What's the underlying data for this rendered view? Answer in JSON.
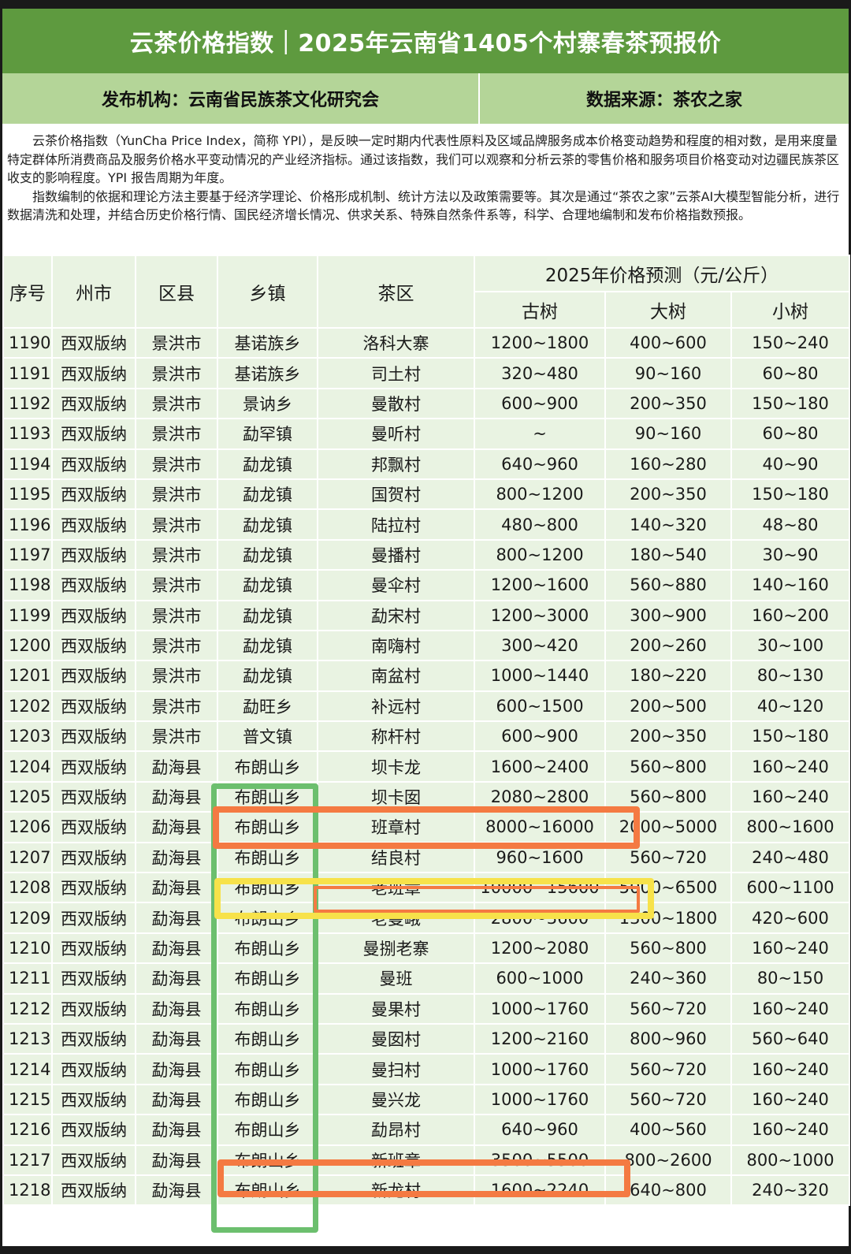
{
  "title": "云茶价格指数｜2025年云南省1405个村寨春茶预报价",
  "publisher": "发布机构：云南省民族茶文化研究会",
  "source": "数据来源：茶农之家",
  "intro": {
    "p1": "云茶价格指数（YunCha Price Index，简称 YPI），是反映一定时期内代表性原料及区域品牌服务成本价格变动趋势和程度的相对数，是用来度量特定群体所消费商品及服务价格水平变动情况的产业经济指标。通过该指数，我们可以观察和分析云茶的零售价格和服务项目价格变动对边疆民族茶区收支的影响程度。YPI 报告周期为年度。",
    "p2": "指数编制的依据和理论方法主要基于经济学理论、价格形成机制、统计方法以及政策需要等。其次是通过“茶农之家”云茶AI大模型智能分析，进行数据清洗和处理，并结合历史价格行情、国民经济增长情况、供求关系、特殊自然条件系等，科学、合理地编制和发布价格指数预报。"
  },
  "table": {
    "headers": {
      "index": "序号",
      "prefecture": "州市",
      "county": "区县",
      "township": "乡镇",
      "tea_area": "茶区",
      "forecast": "2025年价格预测（元/公斤）",
      "ancient": "古树",
      "large": "大树",
      "small": "小树"
    },
    "rows": [
      [
        "1190",
        "西双版纳",
        "景洪市",
        "基诺族乡",
        "洛科大寨",
        "1200~1800",
        "400~600",
        "150~240"
      ],
      [
        "1191",
        "西双版纳",
        "景洪市",
        "基诺族乡",
        "司土村",
        "320~480",
        "90~160",
        "60~80"
      ],
      [
        "1192",
        "西双版纳",
        "景洪市",
        "景讷乡",
        "曼散村",
        "600~900",
        "200~350",
        "150~180"
      ],
      [
        "1193",
        "西双版纳",
        "景洪市",
        "勐罕镇",
        "曼听村",
        "~",
        "90~160",
        "60~80"
      ],
      [
        "1194",
        "西双版纳",
        "景洪市",
        "勐龙镇",
        "邦飘村",
        "640~960",
        "160~280",
        "40~90"
      ],
      [
        "1195",
        "西双版纳",
        "景洪市",
        "勐龙镇",
        "国贺村",
        "800~1200",
        "200~350",
        "150~180"
      ],
      [
        "1196",
        "西双版纳",
        "景洪市",
        "勐龙镇",
        "陆拉村",
        "480~800",
        "140~320",
        "48~80"
      ],
      [
        "1197",
        "西双版纳",
        "景洪市",
        "勐龙镇",
        "曼播村",
        "800~1200",
        "180~540",
        "30~90"
      ],
      [
        "1198",
        "西双版纳",
        "景洪市",
        "勐龙镇",
        "曼伞村",
        "1200~1600",
        "560~880",
        "140~160"
      ],
      [
        "1199",
        "西双版纳",
        "景洪市",
        "勐龙镇",
        "勐宋村",
        "1200~3000",
        "300~900",
        "160~200"
      ],
      [
        "1200",
        "西双版纳",
        "景洪市",
        "勐龙镇",
        "南嗨村",
        "300~420",
        "200~260",
        "30~100"
      ],
      [
        "1201",
        "西双版纳",
        "景洪市",
        "勐龙镇",
        "南盆村",
        "1000~1440",
        "180~220",
        "80~130"
      ],
      [
        "1202",
        "西双版纳",
        "景洪市",
        "勐旺乡",
        "补远村",
        "600~1500",
        "200~500",
        "40~120"
      ],
      [
        "1203",
        "西双版纳",
        "景洪市",
        "普文镇",
        "称杆村",
        "600~900",
        "200~350",
        "150~180"
      ],
      [
        "1204",
        "西双版纳",
        "勐海县",
        "布朗山乡",
        "坝卡龙",
        "1600~2400",
        "560~800",
        "160~240"
      ],
      [
        "1205",
        "西双版纳",
        "勐海县",
        "布朗山乡",
        "坝卡囡",
        "2080~2800",
        "560~800",
        "160~240"
      ],
      [
        "1206",
        "西双版纳",
        "勐海县",
        "布朗山乡",
        "班章村",
        "8000~16000",
        "2000~5000",
        "800~1600"
      ],
      [
        "1207",
        "西双版纳",
        "勐海县",
        "布朗山乡",
        "结良村",
        "960~1600",
        "560~720",
        "240~480"
      ],
      [
        "1208",
        "西双版纳",
        "勐海县",
        "布朗山乡",
        "老班章",
        "10000~15600",
        "5000~6500",
        "600~1100"
      ],
      [
        "1209",
        "西双版纳",
        "勐海县",
        "布朗山乡",
        "老曼峨",
        "2800~3600",
        "1300~1800",
        "420~600"
      ],
      [
        "1210",
        "西双版纳",
        "勐海县",
        "布朗山乡",
        "曼捌老寨",
        "1200~2080",
        "560~800",
        "160~240"
      ],
      [
        "1211",
        "西双版纳",
        "勐海县",
        "布朗山乡",
        "曼班",
        "600~1000",
        "240~360",
        "80~150"
      ],
      [
        "1212",
        "西双版纳",
        "勐海县",
        "布朗山乡",
        "曼果村",
        "1000~1760",
        "560~720",
        "160~240"
      ],
      [
        "1213",
        "西双版纳",
        "勐海县",
        "布朗山乡",
        "曼囡村",
        "1200~2160",
        "800~960",
        "560~640"
      ],
      [
        "1214",
        "西双版纳",
        "勐海县",
        "布朗山乡",
        "曼扫村",
        "1000~1760",
        "560~720",
        "160~240"
      ],
      [
        "1215",
        "西双版纳",
        "勐海县",
        "布朗山乡",
        "曼兴龙",
        "1000~1760",
        "560~720",
        "160~240"
      ],
      [
        "1216",
        "西双版纳",
        "勐海县",
        "布朗山乡",
        "勐昂村",
        "640~960",
        "400~560",
        "160~240"
      ],
      [
        "1217",
        "西双版纳",
        "勐海县",
        "布朗山乡",
        "新班章",
        "3500~5500",
        "800~2600",
        "800~1000"
      ],
      [
        "1218",
        "西双版纳",
        "勐海县",
        "布朗山乡",
        "新龙村",
        "1600~2240",
        "640~800",
        "240~320"
      ]
    ]
  },
  "colors": {
    "title_bg": "#5e9a3f",
    "info_bg": "#b4d598",
    "cell_bg": "#e9f3e2",
    "highlight_green": "#6cbf6e",
    "highlight_orange": "#f47a42",
    "highlight_yellow": "#f7e24a"
  }
}
